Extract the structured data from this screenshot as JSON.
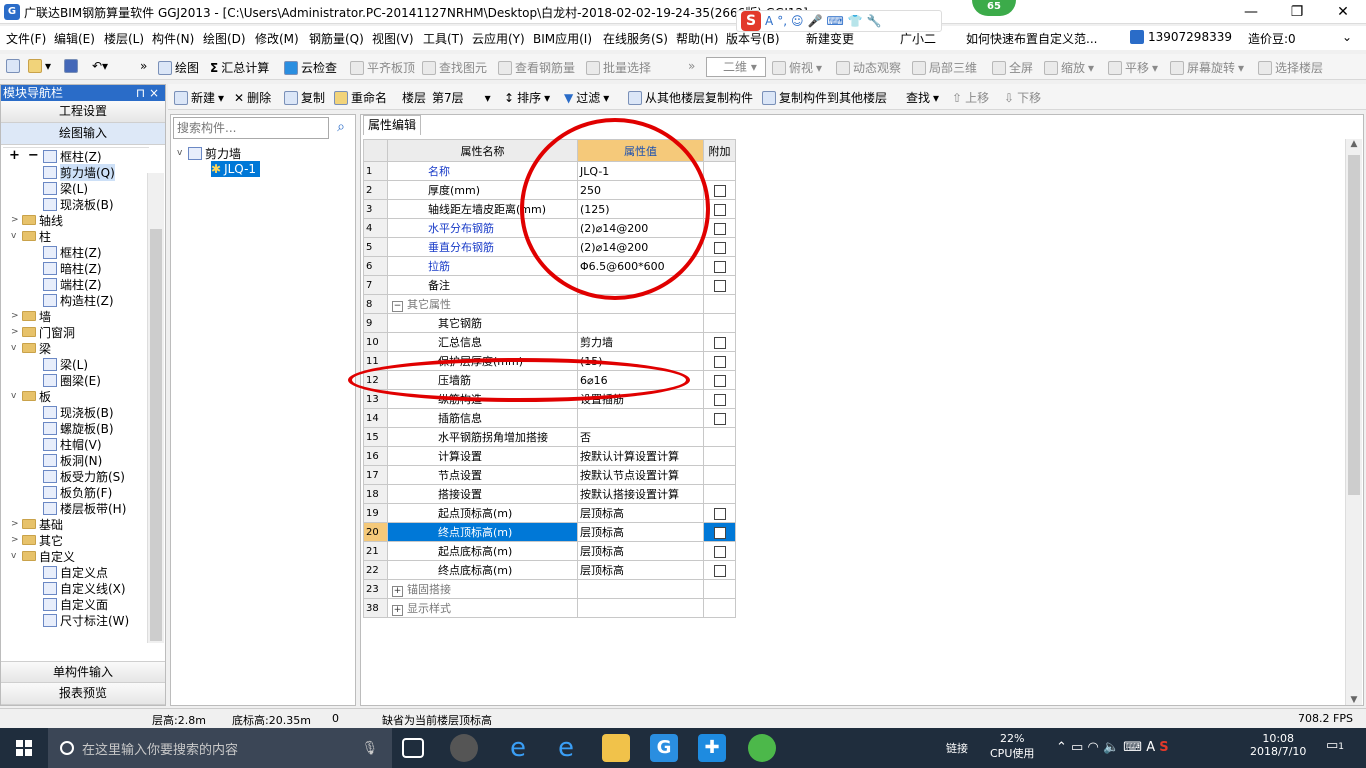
{
  "window": {
    "title": "广联达BIM钢筋算量软件 GGJ2013 - [C:\\Users\\Administrator.PC-20141127NRHM\\Desktop\\白龙村-2018-02-02-19-24-35(2666版).GGJ12]"
  },
  "ime": {
    "letters": "A",
    "badge": "65"
  },
  "menubar": {
    "items": [
      "文件(F)",
      "编辑(E)",
      "楼层(L)",
      "构件(N)",
      "绘图(D)",
      "修改(M)",
      "钢筋量(Q)",
      "视图(V)",
      "工具(T)",
      "云应用(Y)",
      "BIM应用(I)",
      "在线服务(S)",
      "帮助(H)",
      "版本号(B)",
      "新建变更",
      "广小二"
    ],
    "promo": "如何快速布置自定义范...",
    "phone": "13907298339",
    "coins": "造价豆:0"
  },
  "toolbar1": {
    "draw": "绘图",
    "sum": "汇总计算",
    "cloud_check": "云检查",
    "flat_top": "平齐板顶",
    "find_elem": "查找图元",
    "view_qty": "查看钢筋量",
    "batch_select": "批量选择",
    "view_mode": "二维",
    "top_view": "俯视",
    "dynamic": "动态观察",
    "local_3d": "局部三维",
    "fullscreen": "全屏",
    "zoom": "缩放",
    "pan": "平移",
    "rotate": "屏幕旋转",
    "select_floor": "选择楼层"
  },
  "toolbar2": {
    "new": "新建",
    "delete": "删除",
    "copy": "复制",
    "rename": "重命名",
    "floor_label": "楼层",
    "floor_value": "第7层",
    "sort": "排序",
    "filter": "过滤",
    "copy_from": "从其他楼层复制构件",
    "copy_to": "复制构件到其他楼层",
    "find": "查找",
    "move_up": "上移",
    "move_down": "下移"
  },
  "nav": {
    "title": "模块导航栏",
    "project_settings": "工程设置",
    "drawing_input": "绘图输入",
    "single_input": "单构件输入",
    "report_preview": "报表预览",
    "tree": [
      {
        "label": "框柱(Z)",
        "level": 2,
        "type": "comp"
      },
      {
        "label": "剪力墙(Q)",
        "level": 2,
        "type": "comp",
        "selected": true
      },
      {
        "label": "梁(L)",
        "level": 2,
        "type": "comp"
      },
      {
        "label": "现浇板(B)",
        "level": 2,
        "type": "comp"
      },
      {
        "label": "轴线",
        "level": 1,
        "type": "folder",
        "exp": ">"
      },
      {
        "label": "柱",
        "level": 1,
        "type": "folder",
        "exp": "v"
      },
      {
        "label": "框柱(Z)",
        "level": 2,
        "type": "comp"
      },
      {
        "label": "暗柱(Z)",
        "level": 2,
        "type": "comp"
      },
      {
        "label": "端柱(Z)",
        "level": 2,
        "type": "comp"
      },
      {
        "label": "构造柱(Z)",
        "level": 2,
        "type": "comp"
      },
      {
        "label": "墙",
        "level": 1,
        "type": "folder",
        "exp": ">"
      },
      {
        "label": "门窗洞",
        "level": 1,
        "type": "folder",
        "exp": ">"
      },
      {
        "label": "梁",
        "level": 1,
        "type": "folder",
        "exp": "v"
      },
      {
        "label": "梁(L)",
        "level": 2,
        "type": "comp"
      },
      {
        "label": "圈梁(E)",
        "level": 2,
        "type": "comp"
      },
      {
        "label": "板",
        "level": 1,
        "type": "folder",
        "exp": "v"
      },
      {
        "label": "现浇板(B)",
        "level": 2,
        "type": "comp"
      },
      {
        "label": "螺旋板(B)",
        "level": 2,
        "type": "comp"
      },
      {
        "label": "柱帽(V)",
        "level": 2,
        "type": "comp"
      },
      {
        "label": "板洞(N)",
        "level": 2,
        "type": "comp"
      },
      {
        "label": "板受力筋(S)",
        "level": 2,
        "type": "comp"
      },
      {
        "label": "板负筋(F)",
        "level": 2,
        "type": "comp"
      },
      {
        "label": "楼层板带(H)",
        "level": 2,
        "type": "comp"
      },
      {
        "label": "基础",
        "level": 1,
        "type": "folder",
        "exp": ">"
      },
      {
        "label": "其它",
        "level": 1,
        "type": "folder",
        "exp": ">"
      },
      {
        "label": "自定义",
        "level": 1,
        "type": "folder",
        "exp": "v"
      },
      {
        "label": "自定义点",
        "level": 2,
        "type": "comp"
      },
      {
        "label": "自定义线(X)",
        "level": 2,
        "type": "comp"
      },
      {
        "label": "自定义面",
        "level": 2,
        "type": "comp"
      },
      {
        "label": "尺寸标注(W)",
        "level": 2,
        "type": "comp"
      }
    ]
  },
  "components": {
    "search_placeholder": "搜索构件...",
    "root": "剪力墙",
    "child": "JLQ-1"
  },
  "props": {
    "tab": "属性编辑",
    "headers": {
      "name": "属性名称",
      "value": "属性值",
      "add": "附加"
    },
    "rows": [
      {
        "n": "1",
        "name": "名称",
        "value": "JLQ-1",
        "style": "blue",
        "cb": false,
        "indent": 0
      },
      {
        "n": "2",
        "name": "厚度(mm)",
        "value": "250",
        "style": "",
        "cb": true,
        "indent": 0
      },
      {
        "n": "3",
        "name": "轴线距左墙皮距离(mm)",
        "value": "(125)",
        "style": "",
        "cb": true,
        "indent": 0
      },
      {
        "n": "4",
        "name": "水平分布钢筋",
        "value": "(2)⌀14@200",
        "style": "blue",
        "cb": true,
        "indent": 0
      },
      {
        "n": "5",
        "name": "垂直分布钢筋",
        "value": "(2)⌀14@200",
        "style": "blue",
        "cb": true,
        "indent": 0
      },
      {
        "n": "6",
        "name": "拉筋",
        "value": "Φ6.5@600*600",
        "style": "blue",
        "cb": true,
        "indent": 0
      },
      {
        "n": "7",
        "name": "备注",
        "value": "",
        "style": "",
        "cb": true,
        "indent": 0
      },
      {
        "n": "8",
        "name": "其它属性",
        "value": "",
        "style": "gray",
        "cb": null,
        "indent": 0,
        "toggle": "−"
      },
      {
        "n": "9",
        "name": "其它钢筋",
        "value": "",
        "style": "",
        "cb": null,
        "indent": 1
      },
      {
        "n": "10",
        "name": "汇总信息",
        "value": "剪力墙",
        "style": "",
        "cb": true,
        "indent": 1
      },
      {
        "n": "11",
        "name": "保护层厚度(mm)",
        "value": "(15)",
        "style": "",
        "cb": true,
        "indent": 1
      },
      {
        "n": "12",
        "name": "压墙筋",
        "value": "6⌀16",
        "style": "",
        "cb": true,
        "indent": 1
      },
      {
        "n": "13",
        "name": "纵筋构造",
        "value": "设置插筋",
        "style": "",
        "cb": true,
        "indent": 1
      },
      {
        "n": "14",
        "name": "插筋信息",
        "value": "",
        "style": "",
        "cb": true,
        "indent": 1
      },
      {
        "n": "15",
        "name": "水平钢筋拐角增加搭接",
        "value": "否",
        "style": "",
        "cb": null,
        "indent": 1
      },
      {
        "n": "16",
        "name": "计算设置",
        "value": "按默认计算设置计算",
        "style": "",
        "cb": null,
        "indent": 1
      },
      {
        "n": "17",
        "name": "节点设置",
        "value": "按默认节点设置计算",
        "style": "",
        "cb": null,
        "indent": 1
      },
      {
        "n": "18",
        "name": "搭接设置",
        "value": "按默认搭接设置计算",
        "style": "",
        "cb": null,
        "indent": 1
      },
      {
        "n": "19",
        "name": "起点顶标高(m)",
        "value": "层顶标高",
        "style": "",
        "cb": true,
        "indent": 1
      },
      {
        "n": "20",
        "name": "终点顶标高(m)",
        "value": "层顶标高",
        "style": "",
        "cb": true,
        "indent": 1,
        "selected": true
      },
      {
        "n": "21",
        "name": "起点底标高(m)",
        "value": "层顶标高",
        "style": "",
        "cb": true,
        "indent": 1
      },
      {
        "n": "22",
        "name": "终点底标高(m)",
        "value": "层顶标高",
        "style": "",
        "cb": true,
        "indent": 1
      },
      {
        "n": "23",
        "name": "锚固搭接",
        "value": "",
        "style": "gray",
        "cb": null,
        "indent": 0,
        "toggle": "+"
      },
      {
        "n": "38",
        "name": "显示样式",
        "value": "",
        "style": "gray",
        "cb": null,
        "indent": 0,
        "toggle": "+"
      }
    ]
  },
  "status": {
    "floor_height": "层高:2.8m",
    "base_elev": "底标高:20.35m",
    "zero": "0",
    "hint": "缺省为当前楼层顶标高",
    "fps": "708.2 FPS"
  },
  "taskbar": {
    "search_placeholder": "在这里输入你要搜索的内容",
    "cpu_percent": "22%",
    "cpu_label": "CPU使用",
    "link": "链接",
    "ime": "A",
    "time": "10:08",
    "date": "2018/7/10",
    "notif": "1"
  },
  "colors": {
    "accent": "#2a6cc8",
    "selection": "#0078d7",
    "highlight": "#f5c97a",
    "annotation": "#e00000"
  }
}
